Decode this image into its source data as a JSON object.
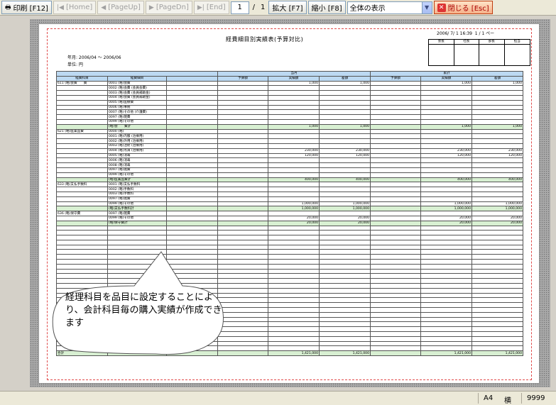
{
  "toolbar": {
    "print": "印刷 [F12]",
    "home": "[Home]",
    "page_up": "[PageUp]",
    "page_dn": "[PageDn]",
    "end": "[End]",
    "current_page": "1",
    "page_sep": "/",
    "total_pages": "1",
    "zoom_in": "拡大 [F7]",
    "zoom_out": "縮小 [F8]",
    "view_mode": "全体の表示",
    "close": "閉じる [Esc]"
  },
  "report": {
    "title": "経費細目別実績表(予算対比)",
    "timestamp": "2006/ 7/ 1 16:39",
    "page_label": "1 / 1 ペー",
    "period": "年月: 2006/04 ～ 2006/06",
    "unit": "単位: 円",
    "stamp_headers": [
      "会長",
      "社長",
      "部長",
      "担当"
    ],
    "col_headers": [
      "経費科目",
      "経費細目",
      "",
      "予算額",
      "実績額",
      "差額",
      "予算額",
      "実績額",
      "差額"
    ],
    "group_headers": [
      "当月",
      "累計"
    ],
    "rows": [
      {
        "type": "",
        "c": [
          "611 (略)会費　　費",
          "0001 (略)会費",
          "",
          "",
          "1,000",
          "1,000",
          "",
          "1,000",
          "1,000"
        ]
      },
      {
        "type": "",
        "c": [
          "",
          "0002 (略)会費 (会員会費)",
          "",
          "",
          "",
          "",
          "",
          "",
          ""
        ]
      },
      {
        "type": "",
        "c": [
          "",
          "0003 (略)会費 (会員補助金)",
          "",
          "",
          "",
          "",
          "",
          "",
          ""
        ]
      },
      {
        "type": "",
        "c": [
          "",
          "0004 (略)会費 (会員補助金)",
          "",
          "",
          "",
          "",
          "",
          "",
          ""
        ]
      },
      {
        "type": "",
        "c": [
          "",
          "0005 (略)医療費",
          "",
          "",
          "",
          "",
          "",
          "",
          ""
        ]
      },
      {
        "type": "",
        "c": [
          "",
          "0006 (略)事務",
          "",
          "",
          "",
          "",
          "",
          "",
          ""
        ]
      },
      {
        "type": "",
        "c": [
          "",
          "0007 (略)その他 (介護費)",
          "",
          "",
          "",
          "",
          "",
          "",
          ""
        ]
      },
      {
        "type": "",
        "c": [
          "",
          "0097 (略)雑費",
          "",
          "",
          "",
          "",
          "",
          "",
          ""
        ]
      },
      {
        "type": "",
        "c": [
          "",
          "0099 (略)その他",
          "",
          "",
          "",
          "",
          "",
          "",
          ""
        ]
      },
      {
        "type": "sub",
        "c": [
          "",
          "(略)会　　費計",
          "",
          "",
          "1,000",
          "1,000",
          "",
          "1,000",
          "1,000"
        ]
      },
      {
        "type": "",
        "c": [
          "621 (略)医薬品費",
          "0000 (略)",
          "",
          "",
          "",
          "",
          "",
          "",
          ""
        ]
      },
      {
        "type": "",
        "c": [
          "",
          "0001 (略)内服 (治療用)",
          "",
          "",
          "",
          "",
          "",
          "",
          ""
        ]
      },
      {
        "type": "",
        "c": [
          "",
          "0002 (略)外用 (治療用)",
          "",
          "",
          "",
          "",
          "",
          "",
          ""
        ]
      },
      {
        "type": "",
        "c": [
          "",
          "0003 (略)注射 (治療用)",
          "",
          "",
          "",
          "",
          "",
          "",
          ""
        ]
      },
      {
        "type": "",
        "c": [
          "",
          "0004 (略)点滴 (治療用)",
          "",
          "",
          "230,000",
          "230,000",
          "",
          "230,000",
          "230,000"
        ]
      },
      {
        "type": "",
        "c": [
          "",
          "0005 (略)消毒",
          "",
          "",
          "120,000",
          "120,000",
          "",
          "120,000",
          "120,000"
        ]
      },
      {
        "type": "",
        "c": [
          "",
          "0006 (略)消毒",
          "",
          "",
          "",
          "",
          "",
          "",
          ""
        ]
      },
      {
        "type": "",
        "c": [
          "",
          "0008 (略)消毒",
          "",
          "",
          "",
          "",
          "",
          "",
          ""
        ]
      },
      {
        "type": "",
        "c": [
          "",
          "0097 (略)雑費",
          "",
          "",
          "",
          "",
          "",
          "",
          ""
        ]
      },
      {
        "type": "",
        "c": [
          "",
          "0099 (略)その他",
          "",
          "",
          "",
          "",
          "",
          "",
          ""
        ]
      },
      {
        "type": "sub",
        "c": [
          "",
          "(略)医薬品費計",
          "",
          "",
          "400,000",
          "400,000",
          "",
          "400,000",
          "400,000"
        ]
      },
      {
        "type": "",
        "c": [
          "633 (略)支払手数料",
          "0001 (略)支払手数料",
          "",
          "",
          "",
          "",
          "",
          "",
          ""
        ]
      },
      {
        "type": "",
        "c": [
          "",
          "0002 (略)手数料",
          "",
          "",
          "",
          "",
          "",
          "",
          ""
        ]
      },
      {
        "type": "",
        "c": [
          "",
          "0003 (略)手数料",
          "",
          "",
          "",
          "",
          "",
          "",
          ""
        ]
      },
      {
        "type": "",
        "c": [
          "",
          "0097 (略)雑費",
          "",
          "",
          "",
          "",
          "",
          "",
          ""
        ]
      },
      {
        "type": "",
        "c": [
          "",
          "0099 (略)その他",
          "",
          "",
          "1,000,000",
          "1,000,000",
          "",
          "1,000,000",
          "1,000,000"
        ]
      },
      {
        "type": "sub",
        "c": [
          "",
          "(略)支払手数料計",
          "",
          "",
          "1,000,000",
          "1,000,000",
          "",
          "1,000,000",
          "1,000,000"
        ]
      },
      {
        "type": "",
        "c": [
          "636 (略)保守費",
          "0097 (略)雑費",
          "",
          "",
          "",
          "",
          "",
          "",
          ""
        ]
      },
      {
        "type": "",
        "c": [
          "",
          "0099 (略)その他",
          "",
          "",
          "20,000",
          "20,000",
          "",
          "20,000",
          "20,000"
        ]
      },
      {
        "type": "sub",
        "c": [
          "",
          "(略)保守費計",
          "",
          "",
          "20,000",
          "20,000",
          "",
          "20,000",
          "20,000"
        ]
      }
    ],
    "total_label": "合計",
    "total_values": [
      "",
      "",
      "1,421,000",
      "1,421,000",
      "",
      "1,421,000",
      "1,421,000"
    ]
  },
  "callout": {
    "text": "経理科目を品目に設定することにより、会計科目毎の購入実績が作成できます"
  },
  "status": {
    "paper": "A4",
    "orientation": "横",
    "count": "9999"
  }
}
